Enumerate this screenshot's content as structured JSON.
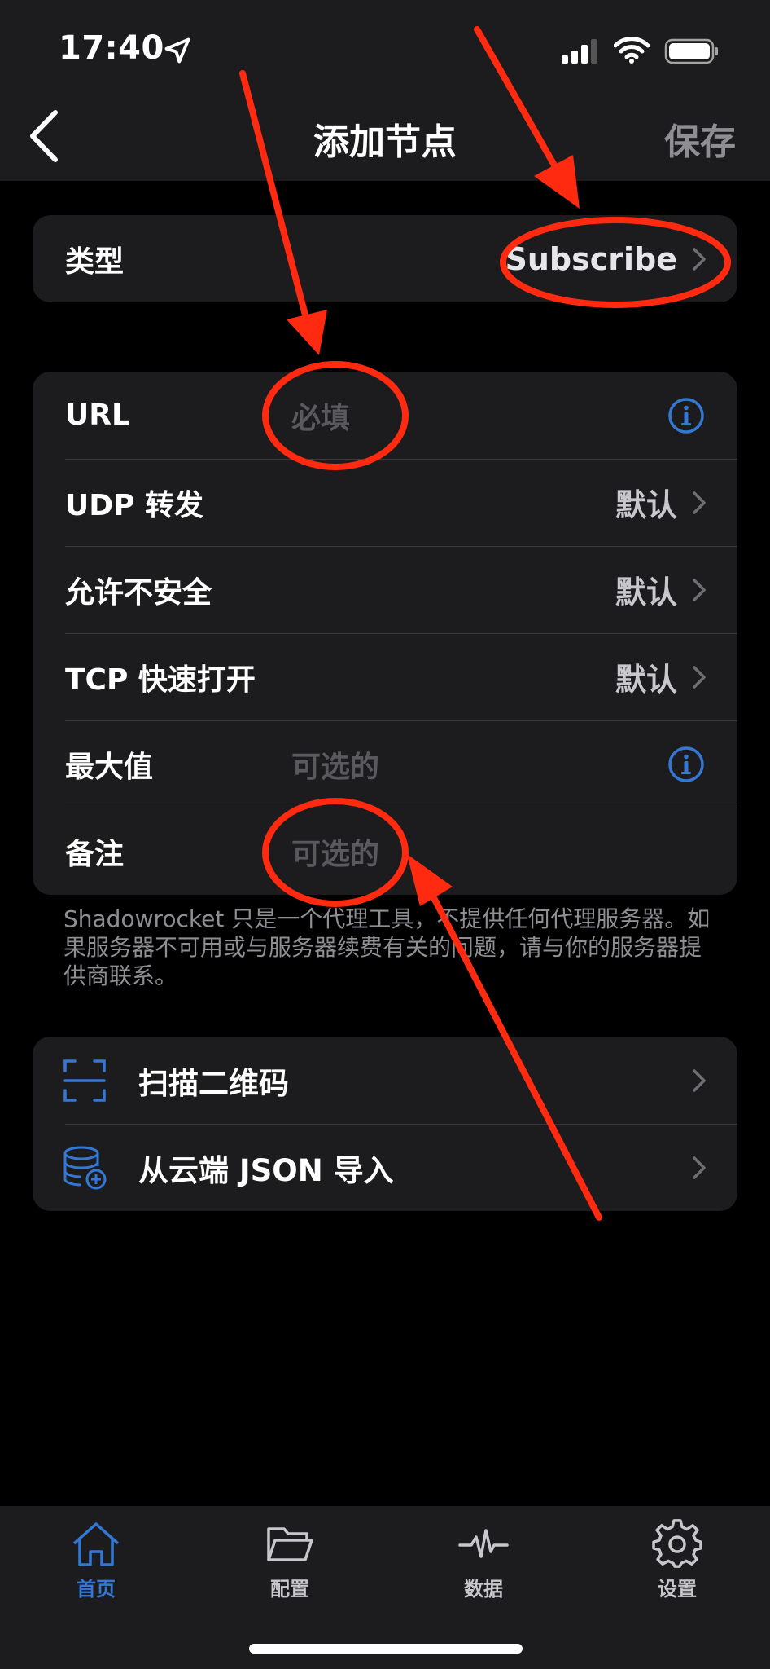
{
  "status_bar": {
    "time": "17:40"
  },
  "nav": {
    "title": "添加节点",
    "save_label": "保存"
  },
  "type_row": {
    "label": "类型",
    "value": "Subscribe"
  },
  "settings": {
    "url": {
      "label": "URL",
      "placeholder": "必填"
    },
    "udp": {
      "label": "UDP 转发",
      "value": "默认"
    },
    "insecure": {
      "label": "允许不安全",
      "value": "默认"
    },
    "tfo": {
      "label": "TCP 快速打开",
      "value": "默认"
    },
    "max": {
      "label": "最大值",
      "placeholder": "可选的"
    },
    "remark": {
      "label": "备注",
      "placeholder": "可选的"
    }
  },
  "footnote": "Shadowrocket 只是一个代理工具，不提供任何代理服务器。如果服务器不可用或与服务器续费有关的问题，请与你的服务器提供商联系。",
  "actions": {
    "scan": {
      "label": "扫描二维码",
      "icon": "qr-scan-icon"
    },
    "json": {
      "label": "从云端 JSON 导入",
      "icon": "database-add-icon"
    }
  },
  "tabbar": {
    "items": [
      {
        "label": "首页",
        "icon": "home-icon",
        "active": true
      },
      {
        "label": "配置",
        "icon": "folder-icon",
        "active": false
      },
      {
        "label": "数据",
        "icon": "pulse-icon",
        "active": false
      },
      {
        "label": "设置",
        "icon": "gear-icon",
        "active": false
      }
    ]
  },
  "colors": {
    "accent": "#3478d6",
    "annotation": "#ff2a10",
    "background": "#000000",
    "cell": "#1c1c1e"
  }
}
